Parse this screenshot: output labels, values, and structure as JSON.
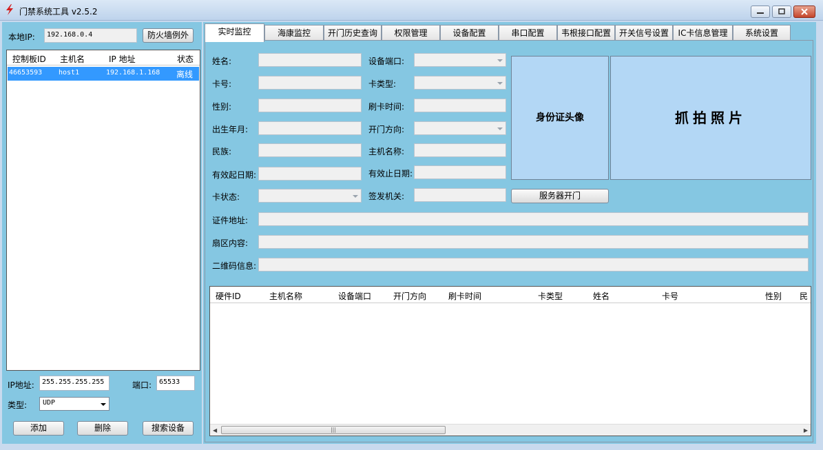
{
  "window": {
    "title": "门禁系统工具  v2.5.2"
  },
  "left": {
    "local_ip_label": "本地IP:",
    "local_ip": "192.168.0.4",
    "firewall_button": "防火墙例外",
    "columns": [
      "控制板ID",
      "主机名",
      "IP 地址",
      "状态"
    ],
    "rows": [
      {
        "id": "46653593",
        "host": "host1",
        "ip": "192.168.1.168",
        "status": "离线"
      }
    ],
    "ip_label": "IP地址:",
    "ip_value": "255.255.255.255",
    "port_label": "端口:",
    "port_value": "65533",
    "type_label": "类型:",
    "type_value": "UDP",
    "add_button": "添加",
    "delete_button": "删除",
    "search_button": "搜索设备"
  },
  "tabs": [
    "实时监控",
    "海康监控",
    "开门历史查询",
    "权限管理",
    "设备配置",
    "串口配置",
    "韦根接口配置",
    "开关信号设置",
    "IC卡信息管理",
    "系统设置"
  ],
  "form": {
    "name": "姓名:",
    "device_port": "设备端口:",
    "card_no": "卡号:",
    "card_type": "卡类型:",
    "gender": "性别:",
    "swipe_time": "刷卡时间:",
    "birth": "出生年月:",
    "door_direction": "开门方向:",
    "ethnicity": "民族:",
    "host_name": "主机名称:",
    "valid_from": "有效起日期:",
    "valid_to": "有效止日期:",
    "card_status": "卡状态:",
    "issuer": "签发机关:",
    "server_open_button": "服务器开门",
    "cert_address": "证件地址:",
    "sector_content": "扇区内容:",
    "qr_info": "二维码信息:"
  },
  "photos": {
    "id_photo": "身份证头像",
    "snapshot": "抓拍照片"
  },
  "grid": {
    "columns": [
      "硬件ID",
      "主机名称",
      "设备端口",
      "开门方向",
      "刷卡时间",
      "卡类型",
      "姓名",
      "卡号",
      "性别",
      "民"
    ]
  },
  "colors": {
    "panel": "#85c7e2",
    "selection": "#3399ff",
    "photo": "#b3d7f5"
  }
}
